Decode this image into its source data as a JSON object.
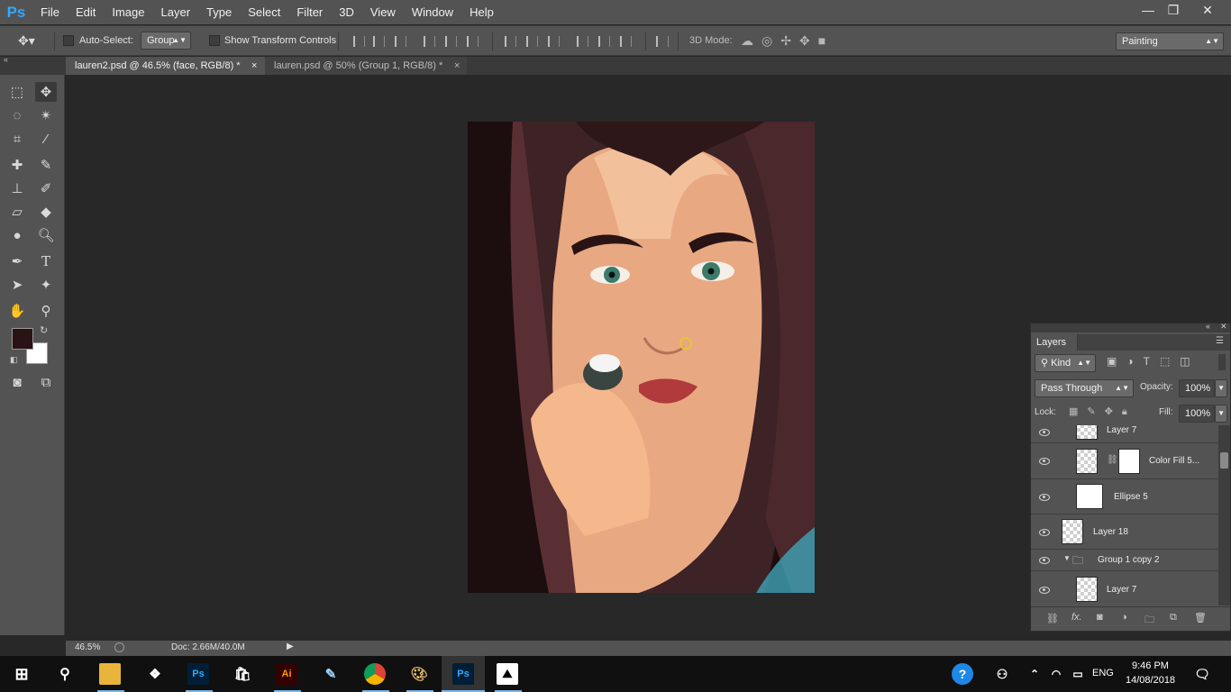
{
  "app": {
    "logo": "Ps"
  },
  "menu": [
    "File",
    "Edit",
    "Image",
    "Layer",
    "Type",
    "Select",
    "Filter",
    "3D",
    "View",
    "Window",
    "Help"
  ],
  "window_controls": {
    "minimize": "—",
    "restore": "❐",
    "close": "✕"
  },
  "options": {
    "auto_select_label": "Auto-Select:",
    "auto_select_value": "Group",
    "show_transform_label": "Show Transform Controls",
    "mode_3d_label": "3D Mode:",
    "workspace": "Painting"
  },
  "tabs": [
    {
      "label": "lauren2.psd @ 46.5% (face, RGB/8) *",
      "close": "×"
    },
    {
      "label": "lauren.psd @ 50% (Group 1, RGB/8) *",
      "close": "×"
    }
  ],
  "colors": {
    "foreground": "#2a1314",
    "background": "#ffffff",
    "accent": "#31a8ff"
  },
  "status": {
    "zoom": "46.5%",
    "doc": "Doc: 2.66M/40.0M"
  },
  "layers_panel": {
    "title": "Layers",
    "filter_kind": "Kind",
    "blend_mode": "Pass Through",
    "opacity_label": "Opacity:",
    "opacity_value": "100%",
    "lock_label": "Lock:",
    "fill_label": "Fill:",
    "fill_value": "100%",
    "layers": [
      {
        "name": "Layer 7"
      },
      {
        "name": "Color Fill 5..."
      },
      {
        "name": "Ellipse 5"
      },
      {
        "name": "Layer 18"
      },
      {
        "name": "Group 1 copy 2"
      },
      {
        "name": "Layer 7"
      }
    ],
    "footer_fx": "fx."
  },
  "taskbar": {
    "lang": "ENG",
    "time": "9:46 PM",
    "date": "14/08/2018",
    "apps": [
      "file-explorer",
      "dropbox",
      "photoshop",
      "store",
      "illustrator",
      "notepad",
      "chrome",
      "paint",
      "photoshop-active",
      "photos"
    ],
    "ps_label": "Ps",
    "ai_label": "Ai"
  }
}
